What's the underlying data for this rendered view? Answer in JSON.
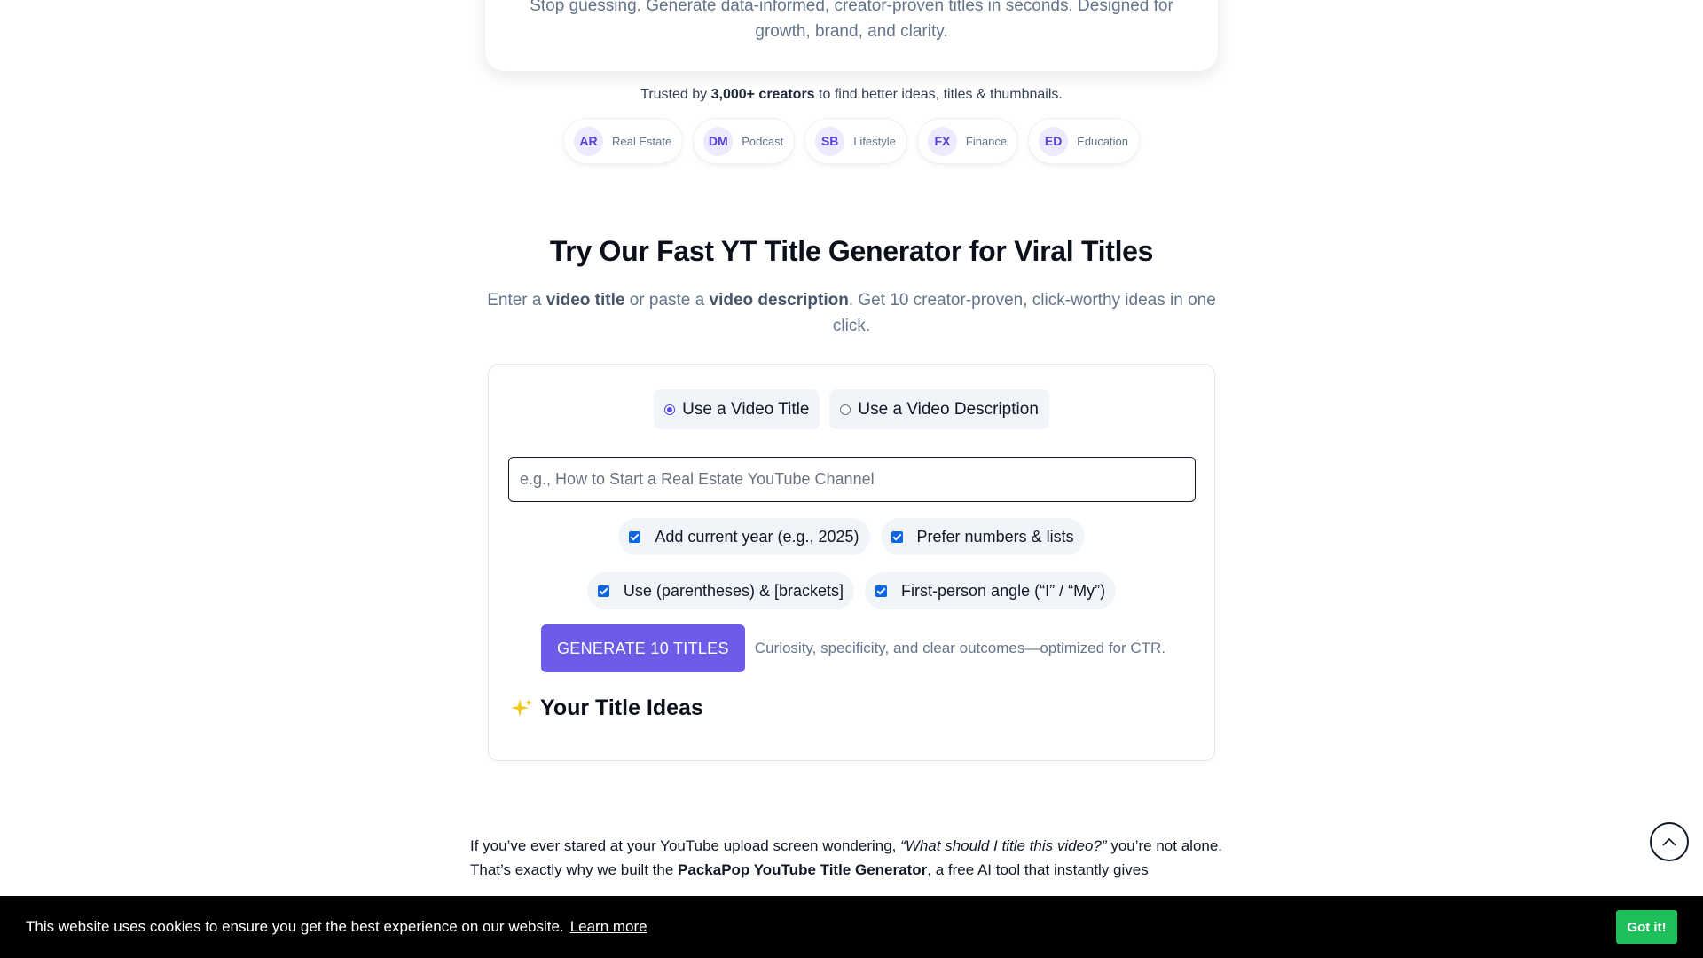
{
  "hero": {
    "subtitle": "Stop guessing. Generate data-informed, creator-proven titles in seconds. Designed for growth, brand, and clarity."
  },
  "trusted": {
    "prefix": "Trusted by",
    "count": "3,000+ creators",
    "suffix": "to find better ideas, titles & thumbnails."
  },
  "creators": [
    {
      "initials": "AR",
      "niche": "Real Estate"
    },
    {
      "initials": "DM",
      "niche": "Podcast"
    },
    {
      "initials": "SB",
      "niche": "Lifestyle"
    },
    {
      "initials": "FX",
      "niche": "Finance"
    },
    {
      "initials": "ED",
      "niche": "Education"
    }
  ],
  "generator": {
    "heading": "Try Our Fast YT Title Generator for Viral Titles",
    "desc_1": "Enter a",
    "desc_b1": "video title",
    "desc_2": "or paste a",
    "desc_b2": "video description",
    "desc_3": ". Get 10 creator-proven, click-worthy ideas in one click.",
    "mode_title": "Use a Video Title",
    "mode_description": "Use a Video Description",
    "input_value": "",
    "input_placeholder": "e.g., How to Start a Real Estate YouTube Channel",
    "opt_year": "Add current year (e.g., 2025)",
    "opt_numbers": "Prefer numbers & lists",
    "opt_brackets": "Use (parentheses) & [brackets]",
    "opt_first_person": "First-person angle (“I” / “My”)",
    "generate_label": "GENERATE 10 TITLES",
    "generate_note": "Curiosity, specificity, and clear outcomes—optimized for CTR.",
    "ideas_heading": "Your Title Ideas"
  },
  "article": {
    "p1_a": "If you’ve ever stared at your YouTube upload screen wondering,",
    "p1_quote": "“What should I title this video?”",
    "p1_b": "you’re not alone.",
    "p2_a": "That’s exactly why we built the",
    "p2_bold": "PackaPop YouTube Title Generator",
    "p2_b": ", a free AI tool that instantly gives"
  },
  "cookie": {
    "message": "This website uses cookies to ensure you get the best experience on our website.",
    "learn_more": "Learn more",
    "accept": "Got it!"
  },
  "colors": {
    "accent": "#6c5ce7",
    "checkbox": "#0b66e4",
    "cookie_accept": "#1fbf5c",
    "sparkle": "#f5c518"
  },
  "icons": {
    "scroll_top": "chevron-up-icon",
    "ideas": "sparkles-icon"
  }
}
